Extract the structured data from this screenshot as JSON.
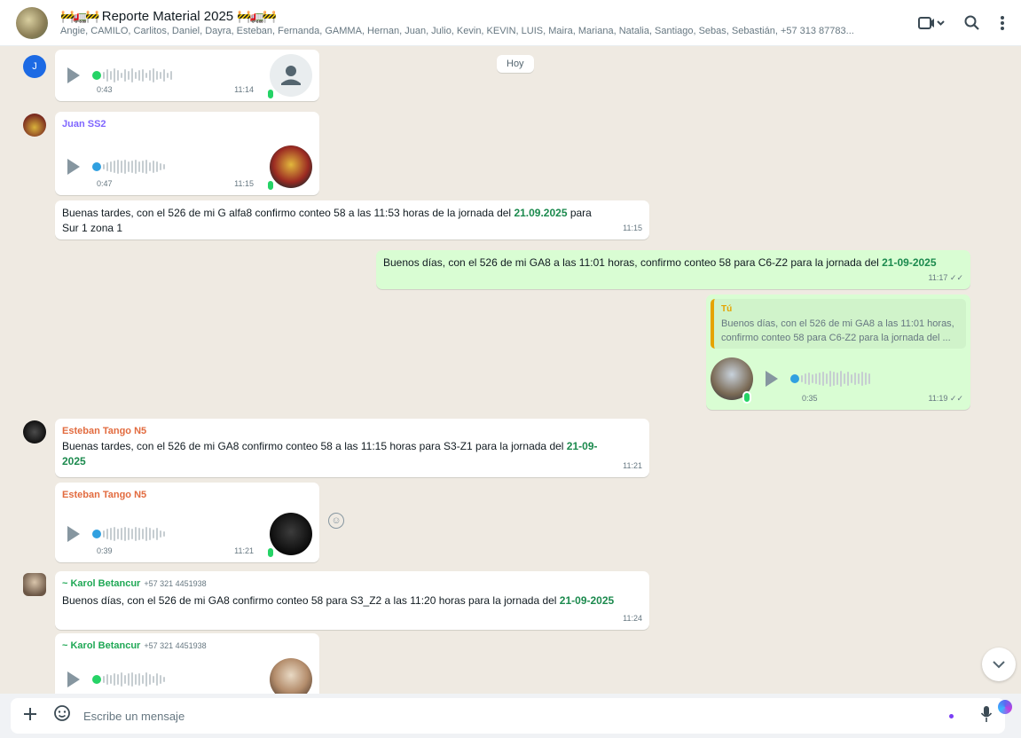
{
  "header": {
    "deco_left": "🚧🚛🚧",
    "title": "Reporte Material 2025",
    "deco_right": "🚧🚛🚧",
    "participants": "Angie, CAMILO, Carlitos, Daniel, Dayra, Esteban, Fernanda, GAMMA, Hernan, Juan, Julio, Kevin, KEVIN, LUIS, Maira, Mariana, Natalia, Santiago, Sebas, Sebastián, +57 313 87783..."
  },
  "date_chip": "Hoy",
  "messages": {
    "m1": {
      "avatar_letter": "J",
      "duration": "0:43",
      "time": "11:14"
    },
    "m2": {
      "sender": "Juan SS2",
      "duration": "0:47",
      "time": "11:15"
    },
    "m3": {
      "text_before": "Buenas tardes, con el 526 de mi G alfa8 confirmo conteo 58 a las 11:53 horas de la jornada del ",
      "date": "21.09.2025",
      "text_after": " para Sur 1 zona 1",
      "time": "11:15"
    },
    "m4": {
      "text_before": "Buenos días, con el 526 de mi GA8 a las 11:01 horas, confirmo conteo 58 para C6-Z2 para la jornada del ",
      "date": "21-09-2025",
      "time": "11:17"
    },
    "m5": {
      "quote_name": "Tú",
      "quote_text": "Buenos días, con el 526 de mi GA8 a las 11:01 horas, confirmo conteo 58 para C6-Z2 para la jornada del ...",
      "duration": "0:35",
      "time": "11:19"
    },
    "m6": {
      "sender": "Esteban Tango N5",
      "text_before": "Buenas tardes, con el 526 de mi GA8 confirmo conteo 58 a las 11:15 horas para S3-Z1 para la jornada del ",
      "date": "21-09-2025",
      "time": "11:21"
    },
    "m7": {
      "sender": "Esteban Tango N5",
      "duration": "0:39",
      "time": "11:21"
    },
    "m8": {
      "sender": "~ Karol Betancur",
      "phone": "+57 321 4451938",
      "text_before": "Buenos días, con el 526 de mi GA8 confirmo conteo 58 para S3_Z2 a las 11:20 horas para la jornada del ",
      "date": "21-09-2025",
      "time": "11:24"
    },
    "m9": {
      "sender": "~ Karol Betancur",
      "phone": "+57 321 4451938"
    }
  },
  "composer": {
    "placeholder": "Escribe un mensaje"
  },
  "icons": {
    "video": "video-call-icon",
    "search": "search-icon",
    "menu": "menu-icon",
    "plus": "plus-icon",
    "sticker": "sticker-icon",
    "mic": "mic-icon"
  }
}
